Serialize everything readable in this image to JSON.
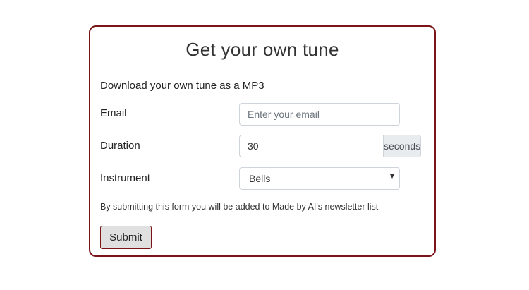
{
  "form": {
    "title": "Get your own tune",
    "intro": "Download your own tune as a MP3",
    "email": {
      "label": "Email",
      "placeholder": "Enter your email",
      "value": ""
    },
    "duration": {
      "label": "Duration",
      "value": "30",
      "unit": "seconds"
    },
    "instrument": {
      "label": "Instrument",
      "selected": "Bells",
      "icon": "chevron-down-icon"
    },
    "notice": "By submitting this form you will be added to Made by AI's newsletter list",
    "submit_label": "Submit"
  },
  "colors": {
    "border_accent": "#7a1418",
    "addon_background": "#e9ecef",
    "button_background": "#e0e0e0"
  }
}
